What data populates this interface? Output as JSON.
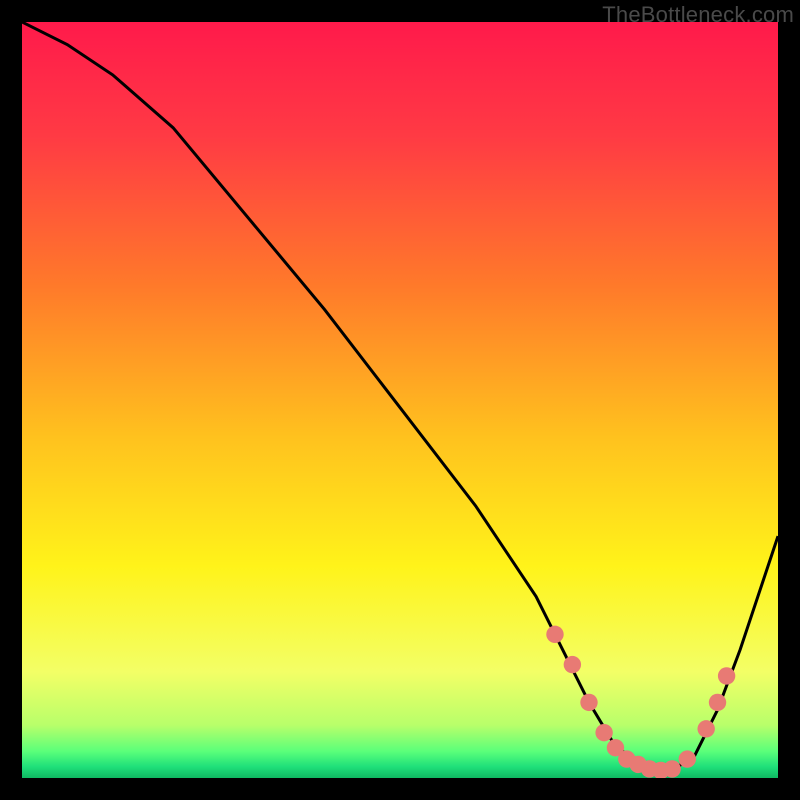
{
  "watermark": "TheBottleneck.com",
  "chart_data": {
    "type": "line",
    "title": "",
    "xlabel": "",
    "ylabel": "",
    "xlim": [
      0,
      100
    ],
    "ylim": [
      0,
      100
    ],
    "curve": {
      "name": "bottleneck-curve",
      "x": [
        0,
        6,
        12,
        20,
        30,
        40,
        50,
        60,
        68,
        72,
        75,
        78,
        81,
        83,
        86,
        89,
        92,
        95,
        100
      ],
      "y": [
        100,
        97,
        93,
        86,
        74,
        62,
        49,
        36,
        24,
        16,
        10,
        5,
        2,
        1,
        1,
        3,
        9,
        17,
        32
      ]
    },
    "markers": {
      "name": "highlight-points",
      "x": [
        70.5,
        72.8,
        75.0,
        77.0,
        78.5,
        80.0,
        81.5,
        83.0,
        84.5,
        86.0,
        88.0,
        90.5,
        92.0,
        93.2
      ],
      "y": [
        19.0,
        15.0,
        10.0,
        6.0,
        4.0,
        2.5,
        1.8,
        1.2,
        1.0,
        1.2,
        2.5,
        6.5,
        10.0,
        13.5
      ]
    },
    "gradient_stops": [
      {
        "offset": 0.0,
        "color": "#ff1a4b"
      },
      {
        "offset": 0.15,
        "color": "#ff3a44"
      },
      {
        "offset": 0.35,
        "color": "#ff7a2a"
      },
      {
        "offset": 0.55,
        "color": "#ffc21e"
      },
      {
        "offset": 0.72,
        "color": "#fff31a"
      },
      {
        "offset": 0.86,
        "color": "#f3ff66"
      },
      {
        "offset": 0.93,
        "color": "#b8ff6a"
      },
      {
        "offset": 0.965,
        "color": "#5aff7a"
      },
      {
        "offset": 0.985,
        "color": "#1fe07a"
      },
      {
        "offset": 1.0,
        "color": "#0fb862"
      }
    ],
    "marker_color": "#e87a74",
    "curve_color": "#000000"
  }
}
